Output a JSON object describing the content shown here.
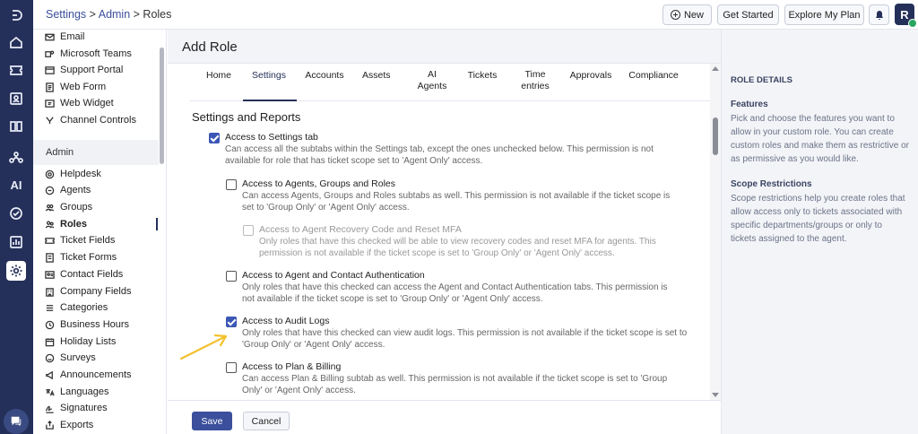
{
  "breadcrumb": {
    "settings": "Settings",
    "sep1": " > ",
    "admin": "Admin",
    "sep2": " > ",
    "current": "Roles"
  },
  "header": {
    "new_label": "New",
    "get_started_label": "Get Started",
    "explore_label": "Explore My Plan",
    "avatar_letter": "R"
  },
  "rail": {
    "ai_label": "AI"
  },
  "nav": {
    "items_top": [
      "Email",
      "Microsoft Teams",
      "Support Portal",
      "Web Form",
      "Web Widget",
      "Channel Controls"
    ],
    "admin_section": "Admin",
    "items_admin": [
      "Helpdesk",
      "Agents",
      "Groups",
      "Roles",
      "Ticket Fields",
      "Ticket Forms",
      "Contact Fields",
      "Company Fields",
      "Categories",
      "Business Hours",
      "Holiday Lists",
      "Surveys",
      "Announcements",
      "Languages",
      "Signatures",
      "Exports"
    ]
  },
  "page": {
    "title": "Add Role"
  },
  "tabs": [
    "Home",
    "Settings",
    "Accounts",
    "Assets",
    "AI Agents",
    "Tickets",
    "Time entries",
    "Approvals",
    "Compliance"
  ],
  "content": {
    "section_title": "Settings and Reports",
    "perms": [
      {
        "label": "Access to Settings tab",
        "desc": "Can access all the subtabs within the Settings tab, except the ones unchecked below. This permission is not available for role that has ticket scope set to 'Agent Only' access."
      },
      {
        "label": "Access to Agents, Groups and Roles",
        "desc": "Can access Agents, Groups and Roles subtabs as well. This permission is not available if the ticket scope is set to 'Group Only' or 'Agent Only' access."
      },
      {
        "label": "Access to Agent Recovery Code and Reset MFA",
        "desc": "Only roles that have this checked will be able to view recovery codes and reset MFA for agents. This permission is not available if the ticket scope is set to 'Group Only' or 'Agent Only' access."
      },
      {
        "label": "Access to Agent and Contact Authentication",
        "desc": "Only roles that have this checked can access the Agent and Contact Authentication tabs. This permission is not available if the ticket scope is set to 'Group Only' or 'Agent Only' access."
      },
      {
        "label": "Access to Audit Logs",
        "desc": "Only roles that have this checked can view audit logs. This permission is not available if the ticket scope is set to 'Group Only' or 'Agent Only' access."
      },
      {
        "label": "Access to Plan & Billing",
        "desc": "Can access Plan & Billing subtab as well. This permission is not available if the ticket scope is set to 'Group Only' or 'Agent Only' access."
      }
    ]
  },
  "footer": {
    "save_label": "Save",
    "cancel_label": "Cancel"
  },
  "details": {
    "title": "ROLE DETAILS",
    "features_title": "Features",
    "features_text": "Pick and choose the features you want to allow in your custom role. You can create custom roles and make them as restrictive or as permissive as you would like.",
    "scope_title": "Scope Restrictions",
    "scope_text": "Scope restrictions help you create roles that allow access only to tickets associated with specific departments/groups or only to tickets assigned to the agent."
  },
  "colors": {
    "rail": "#25305a",
    "accent": "#3b57b5",
    "annotation_arrow": "#f2c12e"
  }
}
